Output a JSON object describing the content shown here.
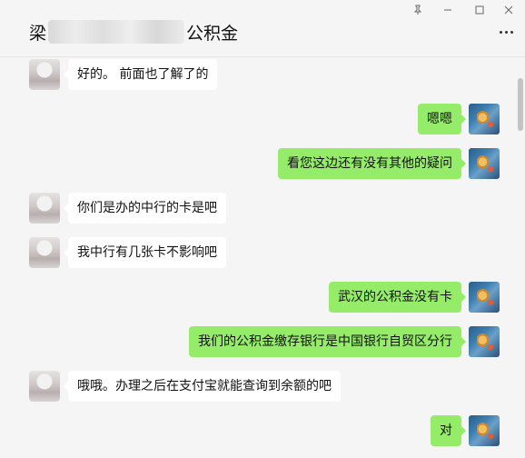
{
  "header": {
    "name_prefix": "梁",
    "name_suffix": "公积金"
  },
  "window_controls": {
    "pin_icon": "pin-icon",
    "minimize_icon": "minimize-icon",
    "maximize_icon": "maximize-icon",
    "close_icon": "close-icon"
  },
  "messages": [
    {
      "side": "left",
      "text": "好的。 前面也了解了的"
    },
    {
      "side": "right",
      "text": "嗯嗯"
    },
    {
      "side": "right",
      "text": "看您这边还有没有其他的疑问"
    },
    {
      "side": "left",
      "text": "你们是办的中行的卡是吧"
    },
    {
      "side": "left",
      "text": "我中行有几张卡不影响吧"
    },
    {
      "side": "right",
      "text": "武汉的公积金没有卡"
    },
    {
      "side": "right",
      "text": "我们的公积金缴存银行是中国银行自贸区分行"
    },
    {
      "side": "left",
      "text": "哦哦。办理之后在支付宝就能查询到余额的吧"
    },
    {
      "side": "right",
      "text": "对"
    }
  ],
  "colors": {
    "background": "#f5f5f5",
    "incoming_bubble": "#ffffff",
    "outgoing_bubble": "#95ec69"
  }
}
